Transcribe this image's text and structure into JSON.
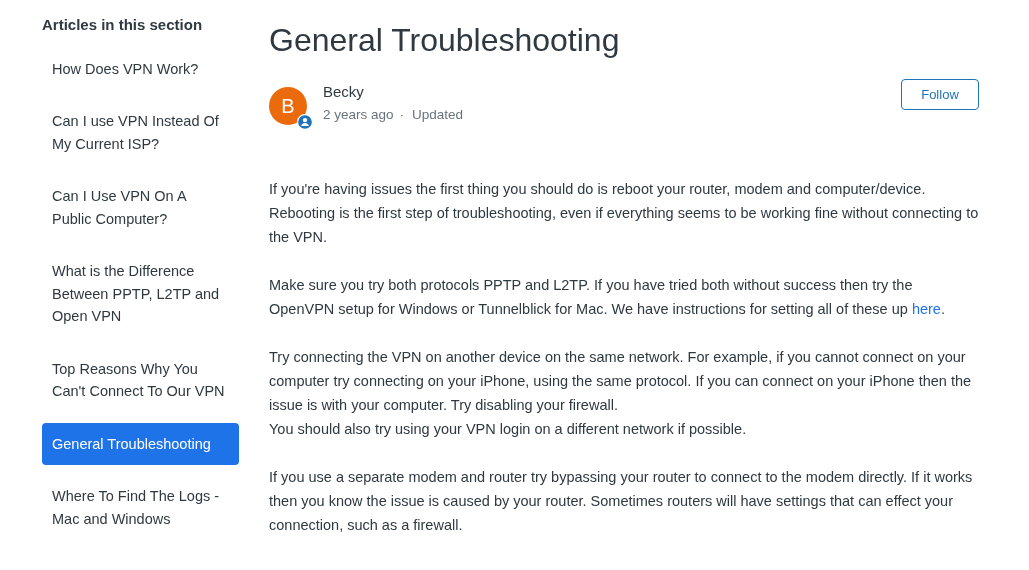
{
  "sidebar": {
    "heading": "Articles in this section",
    "items": [
      {
        "label": "How Does VPN Work?",
        "selected": false
      },
      {
        "label": "Can I use VPN Instead Of My Current ISP?",
        "selected": false
      },
      {
        "label": "Can I Use VPN On A Public Computer?",
        "selected": false
      },
      {
        "label": "What is the Difference Between PPTP, L2TP and Open VPN",
        "selected": false
      },
      {
        "label": "Top Reasons Why You Can't Connect To Our VPN",
        "selected": false
      },
      {
        "label": "General Troubleshooting",
        "selected": true
      },
      {
        "label": "Where To Find The Logs - Mac and Windows",
        "selected": false
      }
    ]
  },
  "article": {
    "title": "General Troubleshooting",
    "author": {
      "initial": "B",
      "name": "Becky",
      "time": "2 years ago",
      "separator": "·",
      "status": "Updated"
    },
    "follow_button": "Follow",
    "paragraphs": [
      {
        "text": "If you're having issues the first thing you should do is reboot your router, modem and computer/device. Rebooting is the first step of troubleshooting, even if everything seems to be working fine without connecting to the VPN."
      },
      {
        "text": "Make sure you try both protocols PPTP and L2TP. If you have tried both without success then try the OpenVPN setup for Windows or Tunnelblick for Mac. We have instructions for setting all of these up ",
        "link": "here",
        "after": "."
      },
      {
        "text": "Try connecting the VPN on another device on the same network. For example, if you cannot connect on your computer try connecting on your iPhone, using the same protocol. If you can connect on your iPhone then the issue is with your computer. Try disabling your firewall.\nYou should also try using your VPN login on a different network if possible."
      },
      {
        "text": "If you use a separate modem and router try bypassing your router to connect to the modem directly. If it works then you know the issue is caused by your router. Sometimes routers will have settings that can effect your connection, such as a firewall."
      }
    ]
  }
}
